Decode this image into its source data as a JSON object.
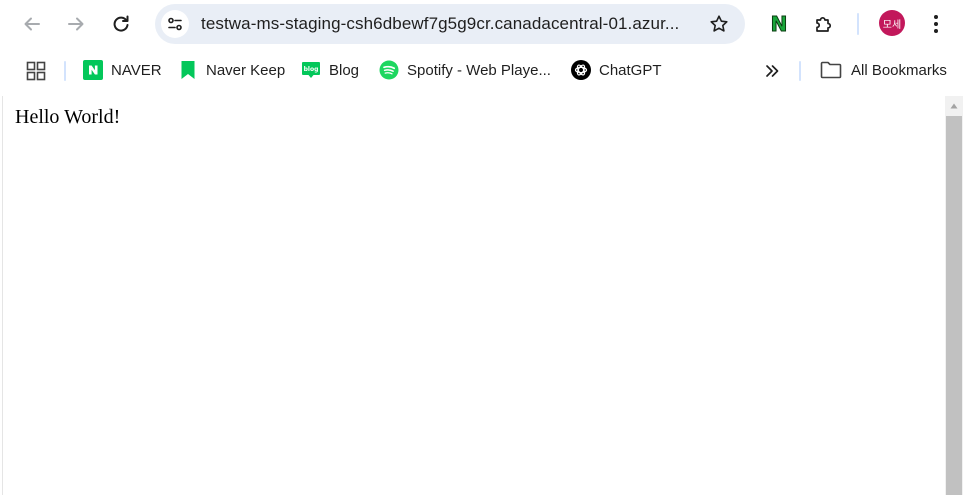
{
  "browser": {
    "url": "testwa-ms-staging-csh6dbewf7g5g9cr.canadacentral-01.azur...",
    "profile_initials": "모세",
    "extension_letter": "N"
  },
  "bookmarks": {
    "items": [
      {
        "label": "NAVER",
        "icon": "naver-icon"
      },
      {
        "label": "Naver Keep",
        "icon": "keep-icon"
      },
      {
        "label": "Blog",
        "icon": "blog-icon",
        "icon_text": "blog"
      },
      {
        "label": "Spotify - Web Playe...",
        "icon": "spotify-icon"
      },
      {
        "label": "ChatGPT",
        "icon": "chatgpt-icon"
      }
    ],
    "all_bookmarks": "All Bookmarks"
  },
  "page": {
    "text": "Hello World!"
  },
  "colors": {
    "naver_green": "#03c75a",
    "avatar": "#c2185b",
    "omnibox_bg": "#e9eef6"
  }
}
